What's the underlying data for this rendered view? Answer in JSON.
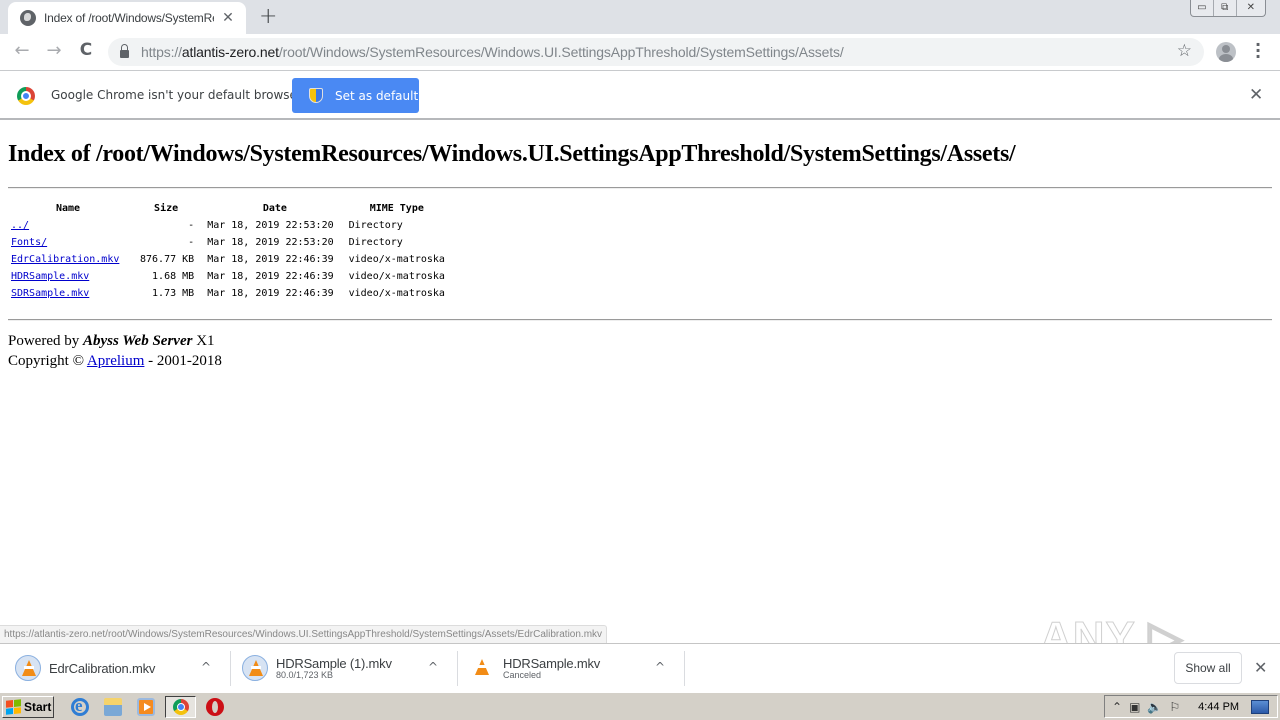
{
  "browser": {
    "tab": {
      "title": "Index of /root/Windows/SystemResources/Windows.UI.SettingsAppThreshold/SystemSettings/Assets/",
      "close": "✕"
    },
    "new_tab": "+",
    "window_controls": {
      "minimize": "▭",
      "restore": "⧉",
      "close": "✕"
    },
    "nav": {
      "back": "←",
      "forward": "→",
      "reload": "C"
    },
    "url": {
      "scheme": "https://",
      "host": "atlantis-zero.net",
      "path": "/root/Windows/SystemResources/Windows.UI.SettingsAppThreshold/SystemSettings/Assets/"
    },
    "star": "☆",
    "menu": "⋮"
  },
  "infobar": {
    "message": "Google Chrome isn't your default browser",
    "button": "Set as default",
    "close": "✕"
  },
  "page": {
    "heading": "Index of /root/Windows/SystemResources/Windows.UI.SettingsAppThreshold/SystemSettings/Assets/",
    "columns": {
      "name": "Name",
      "size": "Size",
      "date": "Date",
      "mime": "MIME Type"
    },
    "rows": [
      {
        "name": "../",
        "size": "-",
        "date": "Mar 18, 2019 22:53:20",
        "mime": "Directory"
      },
      {
        "name": "Fonts/",
        "size": "-",
        "date": "Mar 18, 2019 22:53:20",
        "mime": "Directory"
      },
      {
        "name": "EdrCalibration.mkv",
        "size": "876.77 KB",
        "date": "Mar 18, 2019 22:46:39",
        "mime": "video/x-matroska"
      },
      {
        "name": "HDRSample.mkv",
        "size": "1.68 MB",
        "date": "Mar 18, 2019 22:46:39",
        "mime": "video/x-matroska"
      },
      {
        "name": "SDRSample.mkv",
        "size": "1.73 MB",
        "date": "Mar 18, 2019 22:46:39",
        "mime": "video/x-matroska"
      }
    ],
    "footer": {
      "powered_prefix": "Powered by ",
      "server_name": "Abyss Web Server",
      "server_version": " X1",
      "copyright_prefix": "Copyright © ",
      "company": "Aprelium",
      "copyright_suffix": " - 2001-2018"
    }
  },
  "status_url": "https://atlantis-zero.net/root/Windows/SystemResources/Windows.UI.SettingsAppThreshold/SystemSettings/Assets/EdrCalibration.mkv",
  "watermark": "ANY ▷ RUN",
  "downloads": {
    "items": [
      {
        "name": "EdrCalibration.mkv",
        "status": ""
      },
      {
        "name": "HDRSample (1).mkv",
        "status": "80.0/1,723 KB"
      },
      {
        "name": "HDRSample.mkv",
        "status": "Canceled"
      }
    ],
    "chevron": "^",
    "show_all": "Show all",
    "close": "✕"
  },
  "taskbar": {
    "start": "Start",
    "tray": {
      "expand": "⌃",
      "network": "▣",
      "volume": "🔈",
      "flag": "⚐",
      "clock": "4:44 PM"
    }
  }
}
